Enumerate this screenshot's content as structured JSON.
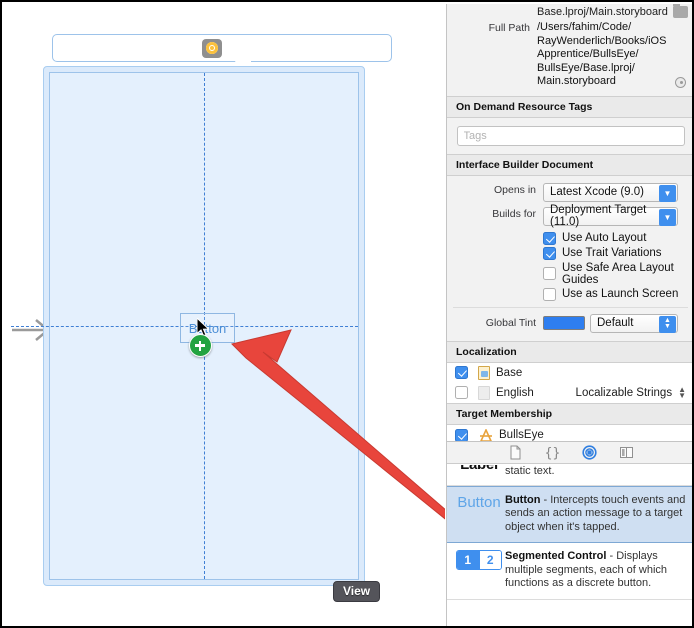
{
  "canvas": {
    "scene_toolbar": {
      "icons": [
        "view-controller-icon",
        "first-responder-icon",
        "exit-icon"
      ]
    },
    "drop_target": {
      "button_label": "Button",
      "badge": "plus-badge"
    },
    "view_chip_label": "View"
  },
  "inspector": {
    "file_name": "Base.lproj/Main.storyboard",
    "full_path_label": "Full Path",
    "full_path_value": "/Users/fahim/Code/\nRayWenderlich/Books/iOS\nApprentice/BullsEye/\nBullsEye/Base.lproj/\nMain.storyboard",
    "sections": {
      "on_demand": {
        "title": "On Demand Resource Tags",
        "tags_placeholder": "Tags",
        "tags_value": ""
      },
      "ib_document": {
        "title": "Interface Builder Document",
        "opens_in_label": "Opens in",
        "opens_in_value": "Latest Xcode (9.0)",
        "builds_for_label": "Builds for",
        "builds_for_value": "Deployment Target (11.0)",
        "checkboxes": [
          {
            "label": "Use Auto Layout",
            "checked": true
          },
          {
            "label": "Use Trait Variations",
            "checked": true
          },
          {
            "label": "Use Safe Area Layout Guides",
            "checked": false
          },
          {
            "label": "Use as Launch Screen",
            "checked": false
          }
        ],
        "global_tint_label": "Global Tint",
        "global_tint_value": "Default",
        "global_tint_color": "#2e7ef0"
      },
      "localization": {
        "title": "Localization",
        "rows": [
          {
            "name": "Base",
            "checked": true,
            "kind": ""
          },
          {
            "name": "English",
            "checked": false,
            "kind": "Localizable Strings"
          }
        ]
      },
      "target_membership": {
        "title": "Target Membership",
        "rows": [
          {
            "name": "BullsEye",
            "checked": true
          }
        ]
      }
    }
  },
  "library": {
    "tabs": [
      {
        "name": "file-template-library-tab",
        "active": false
      },
      {
        "name": "code-snippet-library-tab",
        "active": false
      },
      {
        "name": "object-library-tab",
        "active": true
      },
      {
        "name": "media-library-tab",
        "active": false
      }
    ],
    "items": [
      {
        "glyph": "Label",
        "title": "",
        "description": "static text.",
        "selected": false,
        "clipped": true
      },
      {
        "glyph": "Button",
        "title": "Button",
        "description": " - Intercepts touch events and sends an action message to a target object when it's tapped.",
        "selected": true,
        "clipped": false
      },
      {
        "glyph": "1 2",
        "title": "Segmented Control",
        "description": " - Displays multiple segments, each of which functions as a discrete button.",
        "selected": false,
        "clipped": false
      }
    ]
  }
}
